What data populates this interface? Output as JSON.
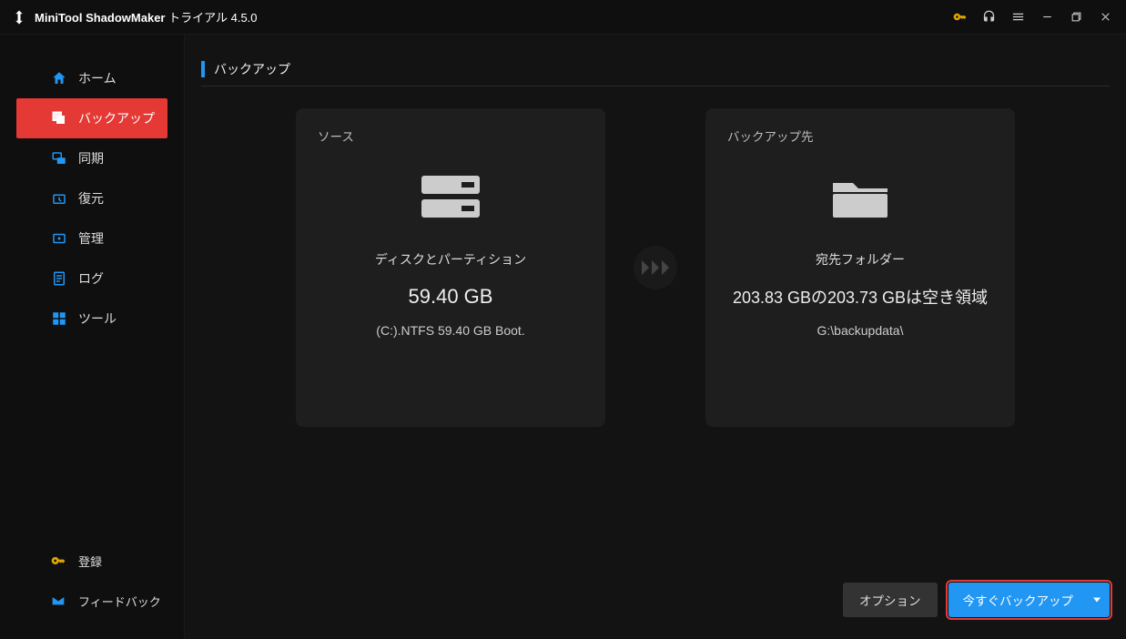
{
  "titlebar": {
    "product": "MiniTool ShadowMaker",
    "edition": "トライアル 4.5.0"
  },
  "sidebar": {
    "items": [
      {
        "label": "ホーム",
        "icon": "home-icon"
      },
      {
        "label": "バックアップ",
        "icon": "backup-icon"
      },
      {
        "label": "同期",
        "icon": "sync-icon"
      },
      {
        "label": "復元",
        "icon": "restore-icon"
      },
      {
        "label": "管理",
        "icon": "manage-icon"
      },
      {
        "label": "ログ",
        "icon": "log-icon"
      },
      {
        "label": "ツール",
        "icon": "tools-icon"
      }
    ],
    "bottom": [
      {
        "label": "登録"
      },
      {
        "label": "フィードバック"
      }
    ]
  },
  "page": {
    "title": "バックアップ"
  },
  "source_card": {
    "heading": "ソース",
    "sub_heading": "ディスクとパーティション",
    "size": "59.40 GB",
    "detail": "(C:).NTFS 59.40 GB Boot."
  },
  "dest_card": {
    "heading": "バックアップ先",
    "sub_heading": "宛先フォルダー",
    "free_space": "203.83 GBの203.73 GBは空き領域",
    "path": "G:\\backupdata\\"
  },
  "actions": {
    "options": "オプション",
    "backup_now": "今すぐバックアップ"
  }
}
